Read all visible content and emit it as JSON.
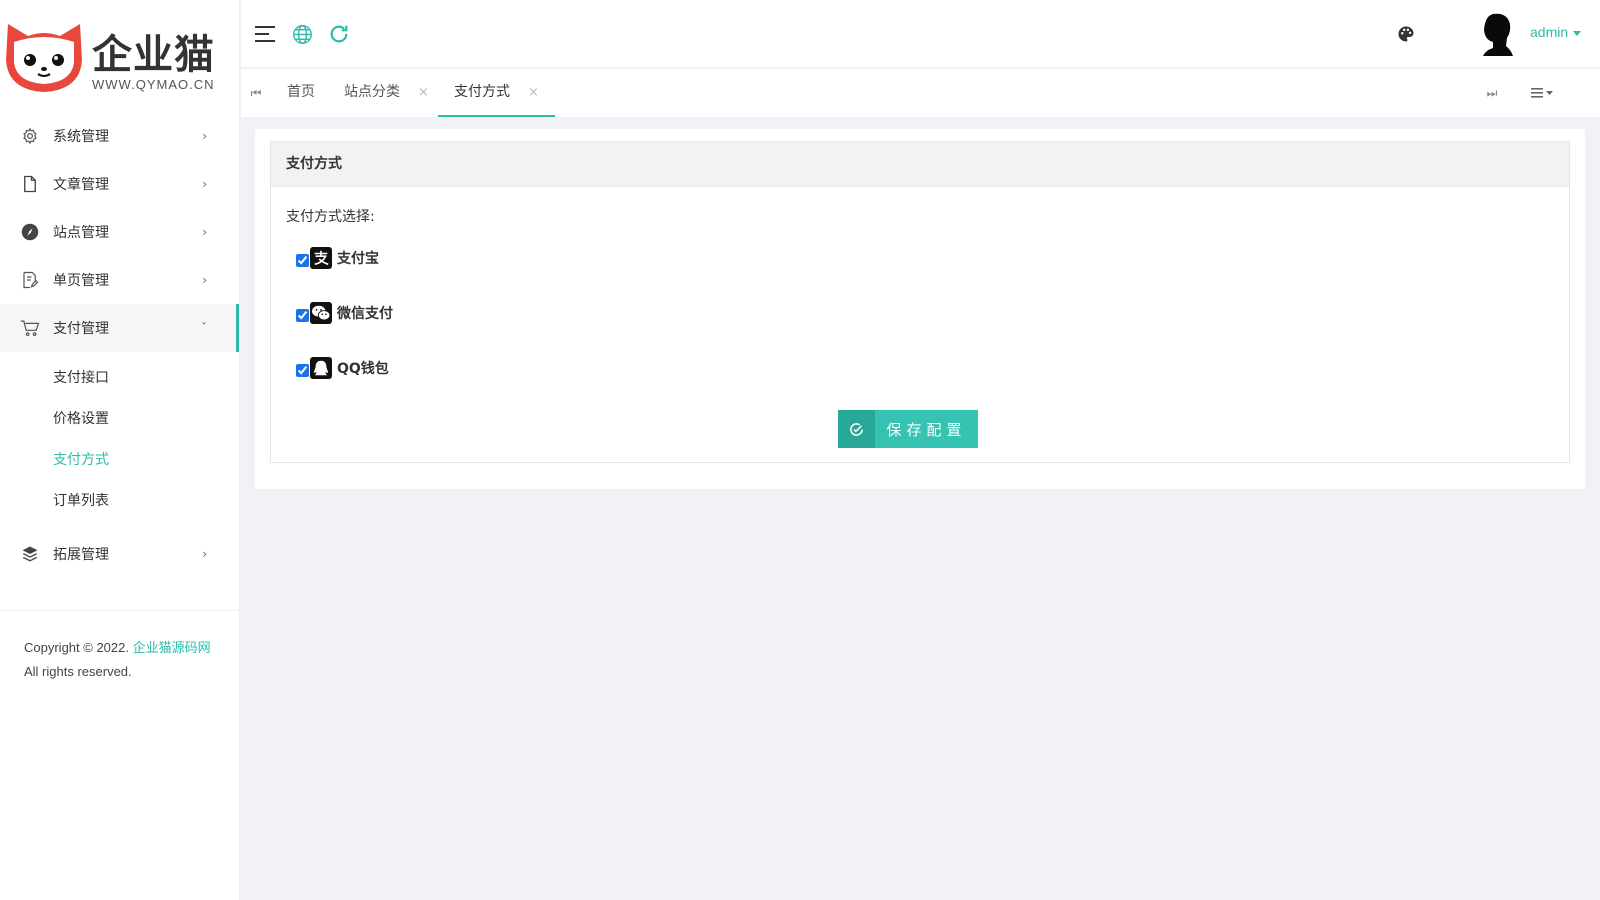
{
  "brand": {
    "name": "企业猫",
    "url": "WWW.QYMAO.CN"
  },
  "sidebar": {
    "items": [
      {
        "label": "系统管理",
        "icon": "gear-icon"
      },
      {
        "label": "文章管理",
        "icon": "document-icon"
      },
      {
        "label": "站点管理",
        "icon": "compass-icon"
      },
      {
        "label": "单页管理",
        "icon": "page-edit-icon"
      },
      {
        "label": "支付管理",
        "icon": "cart-icon"
      },
      {
        "label": "拓展管理",
        "icon": "layers-icon"
      }
    ],
    "sub_items": [
      {
        "label": "支付接口"
      },
      {
        "label": "价格设置"
      },
      {
        "label": "支付方式"
      },
      {
        "label": "订单列表"
      }
    ],
    "active_sub": "支付方式"
  },
  "footer": {
    "copyright": "Copyright © 2022.",
    "link": "企业猫源码网",
    "rights": "All rights reserved."
  },
  "header": {
    "user": "admin"
  },
  "tabs": [
    {
      "label": "首页",
      "closable": false
    },
    {
      "label": "站点分类",
      "closable": true
    },
    {
      "label": "支付方式",
      "closable": true,
      "active": true
    }
  ],
  "tab_close_symbol": "×",
  "panel": {
    "title": "支付方式",
    "field_label": "支付方式选择:",
    "options": [
      {
        "label": "支付宝",
        "checked": true,
        "icon": "alipay-icon"
      },
      {
        "label": "微信支付",
        "checked": true,
        "icon": "wechat-icon"
      },
      {
        "label": "QQ钱包",
        "checked": true,
        "icon": "qq-icon"
      }
    ],
    "save_label": "保存配置"
  },
  "colors": {
    "accent": "#2fb9a9",
    "button": "#36c3b2",
    "button_icon_bg": "#28a899"
  }
}
